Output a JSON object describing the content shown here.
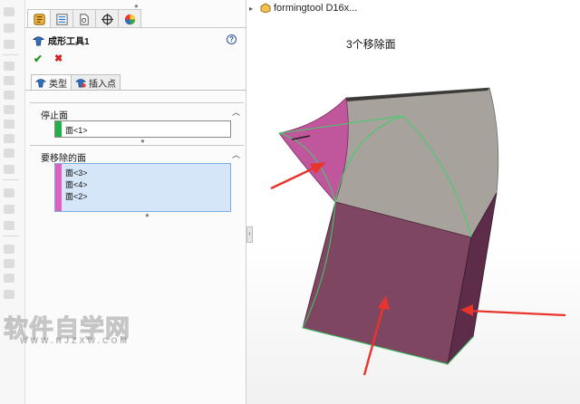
{
  "property_manager": {
    "title": "成形工具1",
    "ok_symbol": "✔",
    "cancel_symbol": "✖",
    "help_symbol": "?",
    "tabs": [
      {
        "label": "类型",
        "icon": "forming-tool-icon"
      },
      {
        "label": "插入点",
        "icon": "insert-point-icon"
      }
    ],
    "stop_face_group": {
      "header": "停止面",
      "selections": [
        "面<1>"
      ],
      "color": "#22b04b"
    },
    "faces_to_remove_group": {
      "header": "要移除的面",
      "selections": [
        "面<3>",
        "面<4>",
        "面<2>"
      ],
      "color": "#e060c0"
    }
  },
  "feature_tree": {
    "root_label": "formingtool D16x..."
  },
  "graphics": {
    "caption": "3个移除面"
  },
  "watermark": {
    "text": "软件自学网",
    "sub": "WWW.RJZXW.COM"
  },
  "colors": {
    "removed_face": "#c0569b",
    "stop_face_body": "#7e4660",
    "gray_face": "#a7a29c",
    "arrow": "#e8342d",
    "edge_highlight": "#3ecf6a"
  }
}
